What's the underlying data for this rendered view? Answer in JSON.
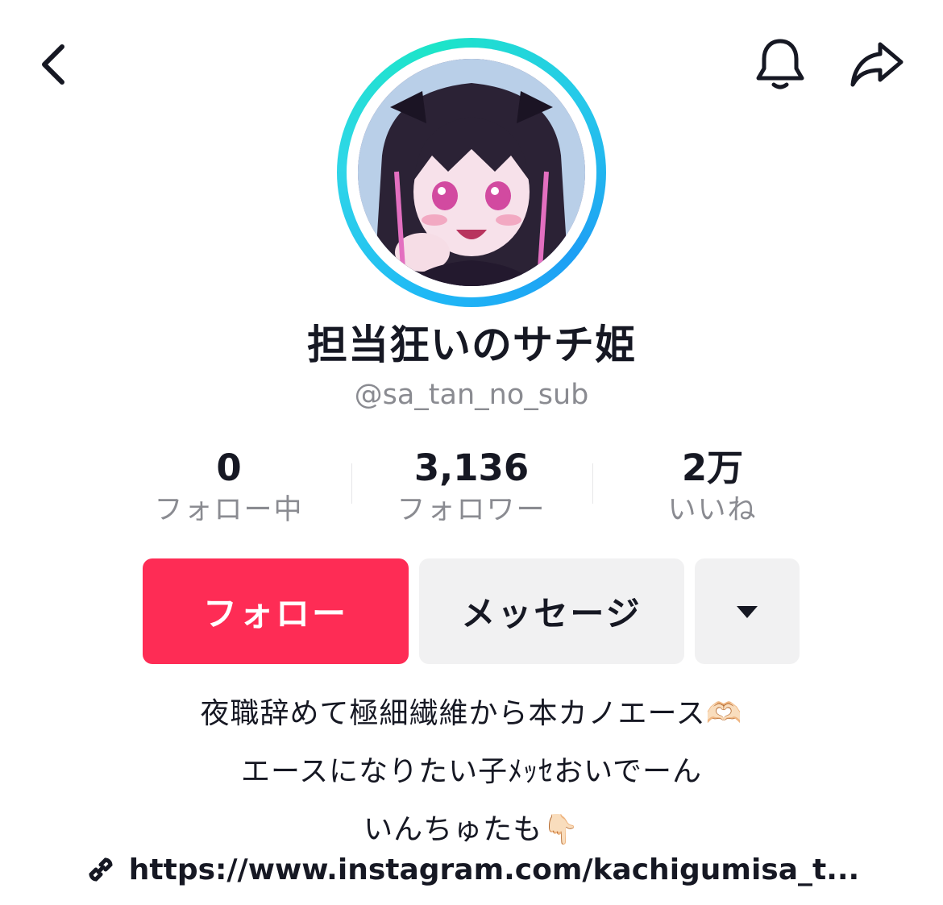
{
  "header": {
    "back_icon": "chevron-left-icon",
    "bell_icon": "bell-icon",
    "share_icon": "share-arrow-icon"
  },
  "profile": {
    "display_name": "担当狂いのサチ姫",
    "username": "@sa_tan_no_sub",
    "ring_colors": [
      "#1fb8f5",
      "#1ce5c8"
    ]
  },
  "stats": [
    {
      "value": "0",
      "label": "フォロー中"
    },
    {
      "value": "3,136",
      "label": "フォロワー"
    },
    {
      "value": "2万",
      "label": "いいね"
    }
  ],
  "actions": {
    "follow_label": "フォロー",
    "message_label": "メッセージ",
    "more_icon": "caret-down-icon",
    "follow_color": "#fe2c55"
  },
  "bio": {
    "line1": "夜職辞めて極細繊維から本カノエース🫶🏻",
    "line2": "エースになりたい子ﾒｯｾおいでーん",
    "line3": "いんちゅたも👇🏻"
  },
  "link": {
    "icon": "link-icon",
    "text": "https://www.instagram.com/kachigumisa_t..."
  }
}
